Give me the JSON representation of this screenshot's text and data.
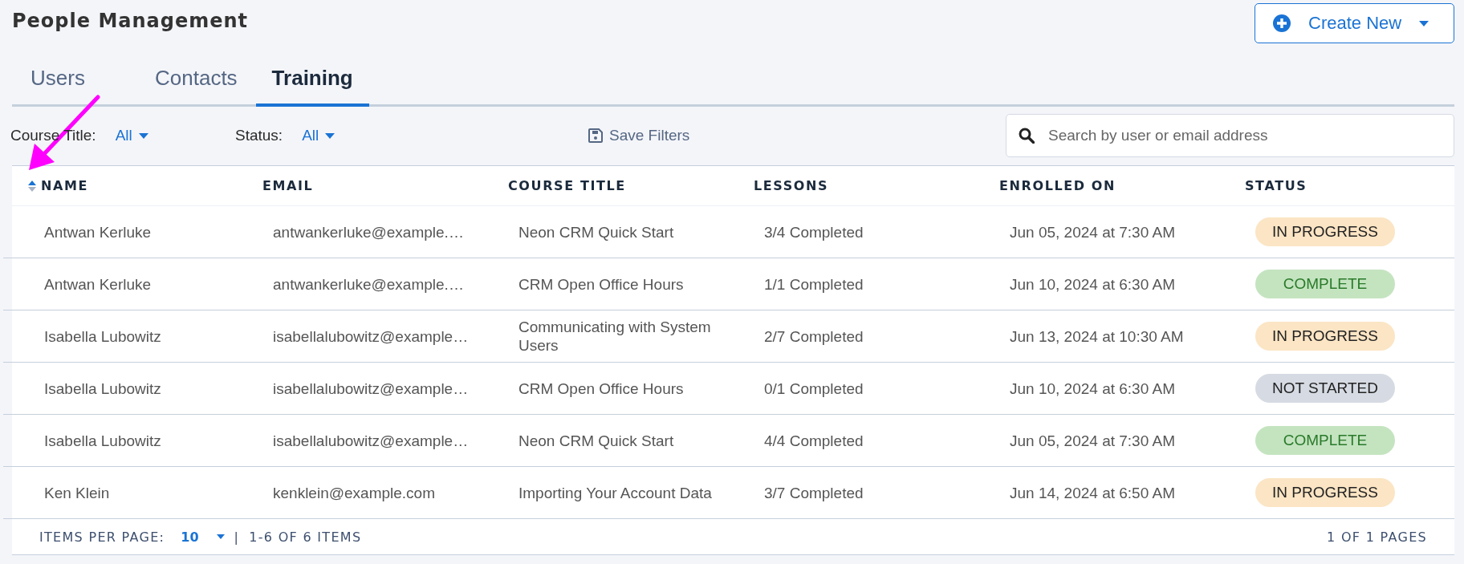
{
  "page": {
    "title": "People Management"
  },
  "create_button": {
    "label": "Create New"
  },
  "tabs": [
    {
      "label": "Users",
      "selected": false
    },
    {
      "label": "Contacts",
      "selected": false
    },
    {
      "label": "Training",
      "selected": true
    }
  ],
  "filters": [
    {
      "label": "Course Title:",
      "value": "All"
    },
    {
      "label": "Status:",
      "value": "All"
    }
  ],
  "save_filters": {
    "label": "Save Filters"
  },
  "search": {
    "placeholder": "Search by user or email address"
  },
  "table": {
    "columns": [
      {
        "label": "NAME",
        "sorted": true
      },
      {
        "label": "EMAIL",
        "sorted": false
      },
      {
        "label": "COURSE TITLE",
        "sorted": false
      },
      {
        "label": "LESSONS",
        "sorted": false
      },
      {
        "label": "ENROLLED ON",
        "sorted": false
      },
      {
        "label": "STATUS",
        "sorted": false
      }
    ],
    "rows": [
      {
        "name": "Antwan Kerluke",
        "email": "antwankerluke@example.…",
        "course": "Neon CRM Quick Start",
        "lessons": "3/4 Completed",
        "enrolled": "Jun 05, 2024 at 7:30 AM",
        "status": "IN PROGRESS",
        "kind": "progress"
      },
      {
        "name": "Antwan Kerluke",
        "email": "antwankerluke@example.…",
        "course": "CRM Open Office Hours",
        "lessons": "1/1 Completed",
        "enrolled": "Jun 10, 2024 at 6:30 AM",
        "status": "COMPLETE",
        "kind": "complete"
      },
      {
        "name": "Isabella Lubowitz",
        "email": "isabellalubowitz@example…",
        "course": "Communicating with System Users",
        "lessons": "2/7 Completed",
        "enrolled": "Jun 13, 2024 at 10:30 AM",
        "status": "IN PROGRESS",
        "kind": "progress"
      },
      {
        "name": "Isabella Lubowitz",
        "email": "isabellalubowitz@example…",
        "course": "CRM Open Office Hours",
        "lessons": "0/1 Completed",
        "enrolled": "Jun 10, 2024 at 6:30 AM",
        "status": "NOT STARTED",
        "kind": "notstarted"
      },
      {
        "name": "Isabella Lubowitz",
        "email": "isabellalubowitz@example…",
        "course": "Neon CRM Quick Start",
        "lessons": "4/4 Completed",
        "enrolled": "Jun 05, 2024 at 7:30 AM",
        "status": "COMPLETE",
        "kind": "complete"
      },
      {
        "name": "Ken Klein",
        "email": "kenklein@example.com",
        "course": "Importing Your Account Data",
        "lessons": "3/7 Completed",
        "enrolled": "Jun 14, 2024 at 6:50 AM",
        "status": "IN PROGRESS",
        "kind": "progress"
      }
    ]
  },
  "pagination": {
    "items_per_page_label": "ITEMS PER PAGE:",
    "items_per_page": "10",
    "separator": "|",
    "range": "1-6 OF 6 ITEMS",
    "pages": "1 OF 1 PAGES"
  }
}
